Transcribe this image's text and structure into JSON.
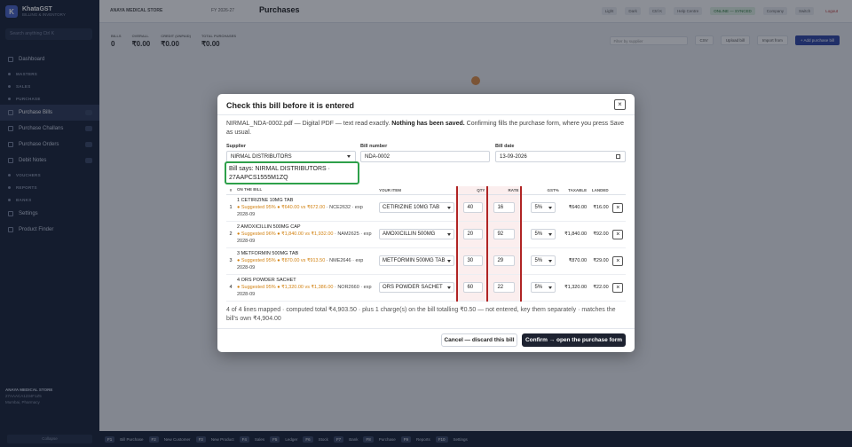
{
  "sidebar": {
    "brand_initial": "K",
    "brand_name": "KhataGST",
    "brand_sub": "BILLING & INVENTORY",
    "search_placeholder": "Search anything  Ctrl K",
    "items": [
      {
        "label": "Dashboard",
        "section": false
      },
      {
        "label": "MASTERS",
        "section": true
      },
      {
        "label": "SALES",
        "section": true
      },
      {
        "label": "PURCHASE",
        "section": true
      },
      {
        "label": "Purchase Bills",
        "section": false,
        "active": true
      },
      {
        "label": "Purchase Challans",
        "section": false
      },
      {
        "label": "Purchase Orders",
        "section": false
      },
      {
        "label": "Debit Notes",
        "section": false
      },
      {
        "label": "VOUCHERS",
        "section": true
      },
      {
        "label": "REPORTS",
        "section": true
      },
      {
        "label": "BANKS",
        "section": true
      },
      {
        "label": "Settings",
        "section": false
      },
      {
        "label": "Product Finder",
        "section": false
      }
    ],
    "footer_shop": "ANAYA MEDICAL STORE",
    "footer_line1": "27AAACA1234F1Z5",
    "footer_line2": "Mumbai, Pharmacy",
    "collapse": "Collapse"
  },
  "topbar": {
    "store": "ANAYA MEDICAL STORE",
    "fy": "FY 2026-27",
    "title": "Purchases",
    "right": [
      "Light",
      "Dark",
      "Ctrl K",
      "Help Centre",
      "ONLINE — SYNCED",
      "Company",
      "Switch",
      "Logout"
    ]
  },
  "summary": [
    {
      "label": "BILLS",
      "value": "0"
    },
    {
      "label": "OVERALL",
      "value": "₹0.00"
    },
    {
      "label": "CREDIT (UNPAID)",
      "value": "₹0.00"
    },
    {
      "label": "TOTAL PURCHASES",
      "value": "₹0.00"
    }
  ],
  "actions": {
    "filter_placeholder": "Filter by supplier",
    "csv": "CSV",
    "upload": "Upload bill",
    "import": "Import from",
    "new": "+ Add purchase bill"
  },
  "modal": {
    "title": "Check this bill before it is entered",
    "close": "×",
    "desc_prefix": "NIRMAL_NDA-0002.pdf — Digital PDF — text read exactly. ",
    "desc_bold": "Nothing has been saved.",
    "desc_suffix": " Confirming fills the purchase form, where you press Save as usual.",
    "supplier_label": "Supplier",
    "supplier_value": "NIRMAL DISTRIBUTORS",
    "bill_number_label": "Bill number",
    "bill_number_value": "NDA-0002",
    "bill_date_label": "Bill date",
    "bill_date_value": "13-09-2026",
    "hint": "Bill says: NIRMAL DISTRIBUTORS · 27AAPCS1555M1ZQ",
    "columns": [
      "#",
      "ON THE BILL",
      "YOUR ITEM",
      "QTY",
      "RATE",
      "GST%",
      "TAXABLE",
      "LANDED"
    ],
    "rows": [
      {
        "n": "1",
        "name": "1 CETIRIZINE 10MG TAB",
        "suggest": "● Suggested 95% ● ₹640.00 vs ₹672.00",
        "meta": " · NCE2632 · exp 2028-09",
        "item": "CETIRIZINE 10MG TAB",
        "qty": "40",
        "rate": "16",
        "gst": "5%",
        "taxable": "₹640.00",
        "landed": "₹16.00"
      },
      {
        "n": "2",
        "name": "2 AMOXICILLIN 500MG CAP",
        "suggest": "● Suggested 96% ● ₹1,840.00 vs ₹1,932.00",
        "meta": " · NAM2625 · exp 2028-09",
        "item": "AMOXICILLIN 500MG",
        "qty": "20",
        "rate": "92",
        "gst": "5%",
        "taxable": "₹1,840.00",
        "landed": "₹92.00"
      },
      {
        "n": "3",
        "name": "3 METFORMIN 500MG TAB",
        "suggest": "● Suggested 95% ● ₹870.00 vs ₹913.50",
        "meta": " · NME2646 · exp 2028-09",
        "item": "METFORMIN 500MG TAB",
        "qty": "30",
        "rate": "29",
        "gst": "5%",
        "taxable": "₹870.00",
        "landed": "₹29.00"
      },
      {
        "n": "4",
        "name": "4 ORS POWDER SACHET",
        "suggest": "● Suggested 95% ● ₹1,320.00 vs ₹1,386.00",
        "meta": " · NOR2660 · exp 2028-09",
        "item": "ORS POWDER SACHET",
        "qty": "60",
        "rate": "22",
        "gst": "5%",
        "taxable": "₹1,320.00",
        "landed": "₹22.00"
      }
    ],
    "footer": "4 of 4 lines mapped · computed total ₹4,903.50 · plus 1 charge(s) on the bill totalling ₹0.50 — not entered, key them separately · matches the bill's own ₹4,904.00",
    "cancel": "Cancel — discard this bill",
    "confirm": "Confirm → open the purchase form"
  },
  "bottombar": [
    "F1",
    "Bill Purchase",
    "F2",
    "New Customer",
    "F3",
    "New Product",
    "F4",
    "Sales",
    "F5",
    "Ledger",
    "F6",
    "Stock",
    "F7",
    "Bank",
    "F8",
    "Purchase",
    "F9",
    "Reports",
    "F10",
    "Settings"
  ]
}
